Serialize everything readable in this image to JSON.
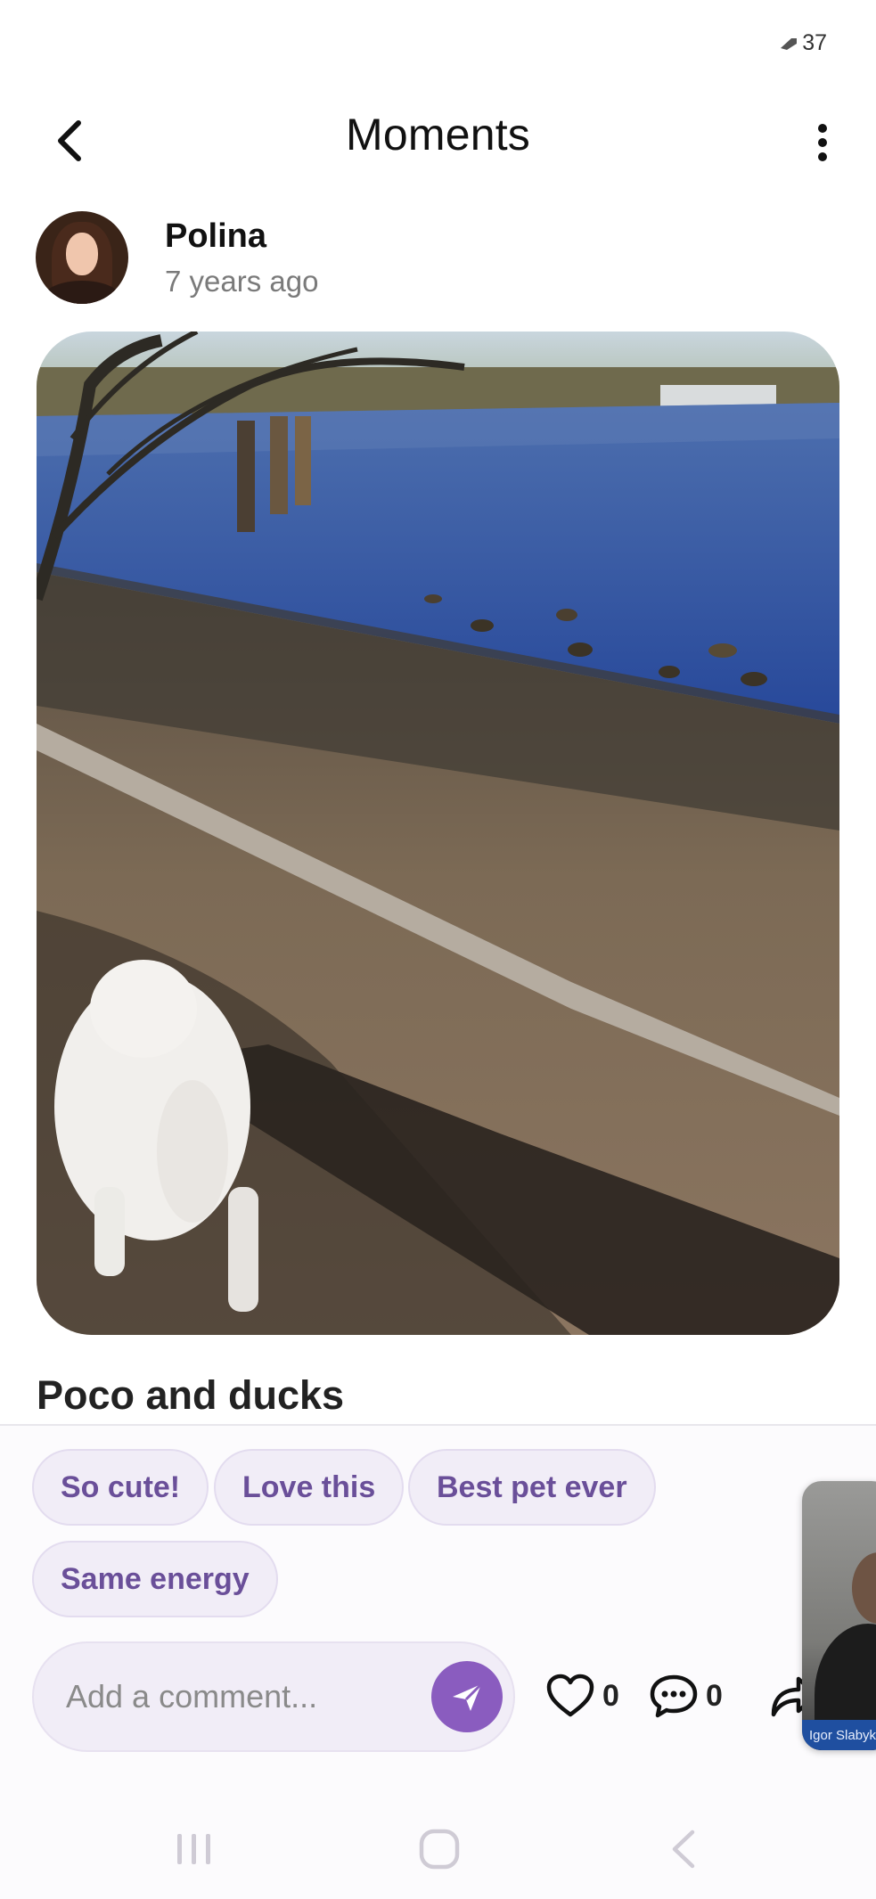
{
  "status_bar": {
    "battery_level": "37"
  },
  "header": {
    "title": "Moments"
  },
  "post": {
    "author_name": "Polina",
    "timestamp": "7 years ago",
    "caption": "Poco and ducks"
  },
  "quick_replies": [
    "So cute!",
    "Love this",
    "Best pet ever",
    "Same energy"
  ],
  "comment": {
    "placeholder": "Add a comment..."
  },
  "stats": {
    "likes": "0",
    "comments": "0"
  },
  "video_call": {
    "participant_name": "Igor Slabyk"
  },
  "colors": {
    "accent": "#8a5cbf",
    "chip_text": "#6a4f99",
    "chip_bg": "#f1edf7"
  },
  "icons": [
    "back-arrow-icon",
    "more-vertical-icon",
    "send-icon",
    "heart-icon",
    "comment-bubble-icon",
    "share-icon",
    "recents-icon",
    "home-icon",
    "system-back-icon"
  ]
}
